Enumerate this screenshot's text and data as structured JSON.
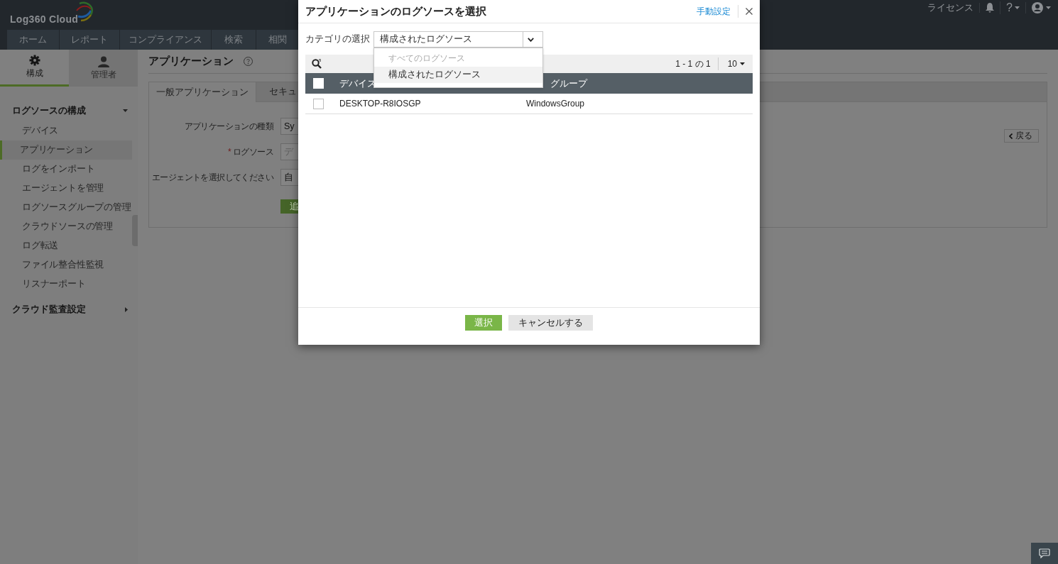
{
  "app": {
    "logo": "Log360 Cloud"
  },
  "top_links": {
    "license": "ライセンス",
    "help": "?"
  },
  "nav_tabs": [
    {
      "label": "ホーム"
    },
    {
      "label": "レポート"
    },
    {
      "label": "コンプライアンス"
    },
    {
      "label": "検索"
    },
    {
      "label": "相関"
    }
  ],
  "sidebar": {
    "modes": [
      {
        "label": "構成",
        "selected": true
      },
      {
        "label": "管理者",
        "selected": false
      }
    ],
    "sections": [
      {
        "title": "ログソースの構成",
        "expanded": true,
        "items": [
          {
            "label": "デバイス",
            "selected": false
          },
          {
            "label": "アプリケーション",
            "selected": true
          },
          {
            "label": "ログをインポート",
            "selected": false
          },
          {
            "label": "エージェントを管理",
            "selected": false
          },
          {
            "label": "ログソースグループの管理",
            "selected": false
          },
          {
            "label": "クラウドソースの管理",
            "selected": false
          },
          {
            "label": "ログ転送",
            "selected": false
          },
          {
            "label": "ファイル整合性監視",
            "selected": false
          },
          {
            "label": "リスナーポート",
            "selected": false
          }
        ]
      },
      {
        "title": "クラウド監査設定",
        "expanded": false
      }
    ]
  },
  "page": {
    "title": "アプリケーション",
    "tabs": [
      {
        "label": "一般アプリケーション",
        "selected": true
      },
      {
        "label": "セキュ",
        "selected": false
      }
    ],
    "form": [
      {
        "label": "アプリケーションの種類",
        "value": "Sy"
      },
      {
        "label": "ログソース",
        "required_mark": "*",
        "placeholder": "デ"
      },
      {
        "label": "エージェントを選択してください",
        "value": "自"
      }
    ],
    "add_button": "追",
    "back_button": "戻る"
  },
  "dialog": {
    "title": "アプリケーションのログソースを選択",
    "manual_link": "手動設定",
    "category": {
      "label": "カテゴリの選択",
      "value": "構成されたログソース",
      "expanded": true,
      "options": [
        {
          "label": "すべてのログソース",
          "selected": false,
          "disabled": true
        },
        {
          "label": "構成されたログソース",
          "selected": true,
          "disabled": false
        }
      ]
    },
    "pagination": {
      "range": "1 - 1 の 1",
      "page_size": "10"
    },
    "table": {
      "header_checked": false,
      "columns": [
        "デバイス",
        "グループ"
      ],
      "rows": [
        {
          "checked": false,
          "cells": [
            "DESKTOP-R8IOSGP",
            "WindowsGroup"
          ]
        }
      ]
    },
    "buttons": [
      {
        "label": "選択",
        "kind": "primary"
      },
      {
        "label": "キャンセルする",
        "kind": "secondary"
      }
    ]
  }
}
